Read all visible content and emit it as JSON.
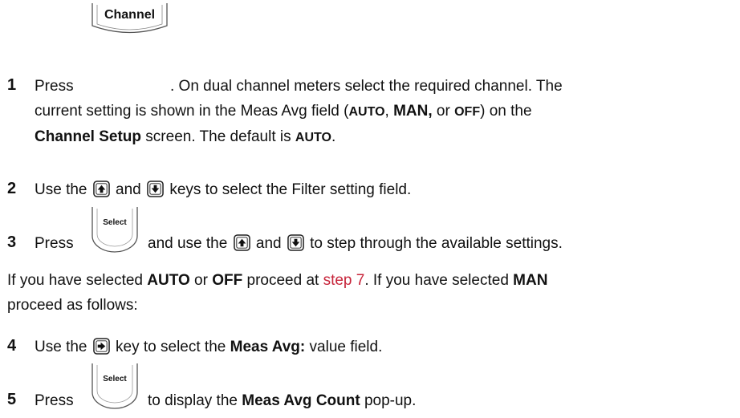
{
  "keys": {
    "channel_label": "Channel",
    "select_label": "Select"
  },
  "steps": {
    "s1": {
      "number": "1",
      "press": "Press",
      "after_key": ". On dual channel meters select the required channel. The",
      "l2_a": "current setting is shown in the Meas Avg field (",
      "auto": "AUTO",
      "comma1": ", ",
      "man": "MAN,",
      "or": " or ",
      "off": "OFF",
      "l2_b": ") on the",
      "channel_setup": "Channel Setup",
      "l3_a": " screen. The default is ",
      "auto2": "AUTO",
      "period": "."
    },
    "s2": {
      "number": "2",
      "use_the": "Use the",
      "and": "and",
      "rest": "keys to select the Filter setting field."
    },
    "s3": {
      "number": "3",
      "press": "Press",
      "and_use_the": "and use the",
      "and": "and",
      "rest": "to step through the available settings."
    },
    "note": {
      "a": "If you have selected ",
      "auto": "AUTO",
      "or": " or ",
      "off": "OFF",
      "proceed": " proceed at ",
      "link": "step 7",
      "b": ". If you have selected ",
      "man": "MAN",
      "c": "proceed as follows:"
    },
    "s4": {
      "number": "4",
      "use_the": "Use the",
      "key_to": "key to select the ",
      "field": "Meas Avg:",
      "rest": " value field."
    },
    "s5": {
      "number": "5",
      "press": "Press",
      "to_display": "to display the ",
      "popup": "Meas Avg Count",
      "rest": " pop-up."
    }
  }
}
